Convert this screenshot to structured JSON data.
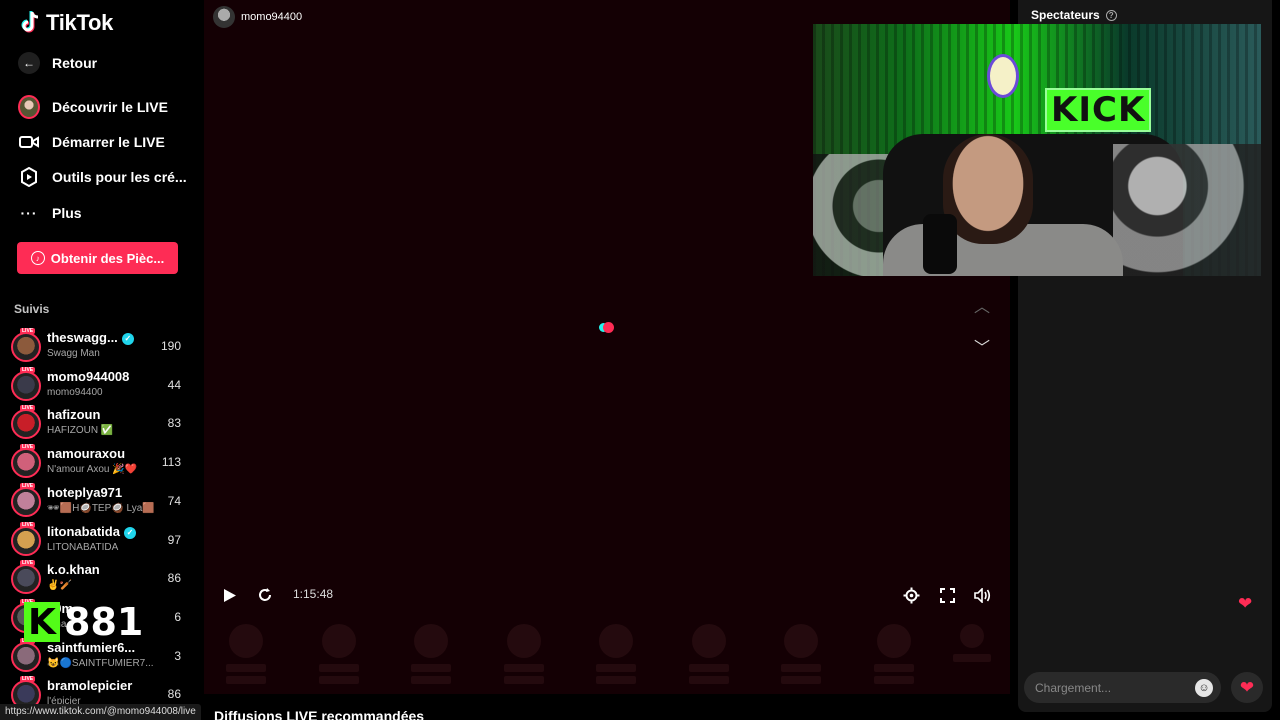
{
  "app": {
    "name": "TikTok"
  },
  "nav": {
    "back": "Retour",
    "discover": "Découvrir le LIVE",
    "start": "Démarrer le LIVE",
    "tools": "Outils pour les cré...",
    "more": "Plus",
    "coins_button": "Obtenir des Pièc..."
  },
  "following": {
    "title": "Suivis",
    "live_badge": "LIVE",
    "items": [
      {
        "name": "theswagg...",
        "sub": "Swagg Man",
        "count": "190",
        "verified": true
      },
      {
        "name": "momo944008",
        "sub": "momo94400",
        "count": "44",
        "verified": false
      },
      {
        "name": "hafizoun",
        "sub": "HAFIZOUN ✅",
        "count": "83",
        "verified": false
      },
      {
        "name": "namouraxou",
        "sub": "N'amour Axou 🎉❤️",
        "count": "113",
        "verified": false
      },
      {
        "name": "hoteplya971",
        "sub": "🕶🟫H🥥TEP🥥 Lya🟫",
        "count": "74",
        "verified": false
      },
      {
        "name": "litonabatida",
        "sub": "LITONABATIDA",
        "count": "97",
        "verified": true
      },
      {
        "name": "k.o.khan",
        "sub": "✌️🏏",
        "count": "86",
        "verified": false
      },
      {
        "name": "00m...",
        "sub": "0ma...",
        "count": "6",
        "verified": false
      },
      {
        "name": "saintfumier6...",
        "sub": "😺🔵SAINTFUMIER7...",
        "count": "3",
        "verified": false
      },
      {
        "name": "bramolepicier",
        "sub": "l'épicier",
        "count": "86",
        "verified": false
      }
    ]
  },
  "overlay": {
    "kick_letter": "K",
    "kick_count": "881"
  },
  "status_url": "https://www.tiktok.com/@momo944008/live",
  "player": {
    "streamer": "momo94400",
    "elapsed": "1:15:48",
    "cam_sign": "KICK"
  },
  "right_panel": {
    "title": "Spectateurs",
    "chat_placeholder": "Chargement..."
  },
  "bottom_heading": "Diffusions LIVE recommandées",
  "colors": {
    "accent": "#fe2c55",
    "cyan": "#25f4ee",
    "kick_green": "#53fc18"
  }
}
